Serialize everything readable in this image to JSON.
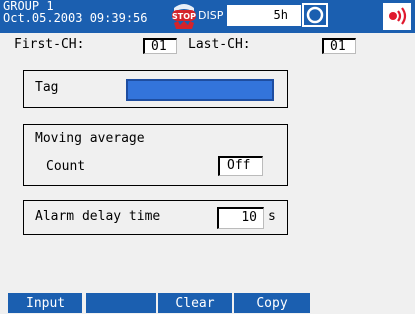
{
  "header": {
    "group": "GROUP 1",
    "datetime": "Oct.05.2003 09:39:56",
    "stop_badge": "STOP",
    "disp_label": "DISP",
    "disp_rate": "5h",
    "colors": {
      "bar": "#1b5fb0",
      "stop": "#d4232b",
      "alarm": "#e0192e"
    }
  },
  "channels": {
    "first_label": "First-CH:",
    "first_value": "01",
    "last_label": "Last-CH:",
    "last_value": "01"
  },
  "tag": {
    "label": "Tag",
    "value": ""
  },
  "moving_average": {
    "title": "Moving average",
    "count_label": "Count",
    "count_value": "Off"
  },
  "alarm_delay": {
    "label": "Alarm delay time",
    "value": "10",
    "unit": "s"
  },
  "softkeys": [
    "Input",
    "",
    "Clear",
    "Copy"
  ]
}
